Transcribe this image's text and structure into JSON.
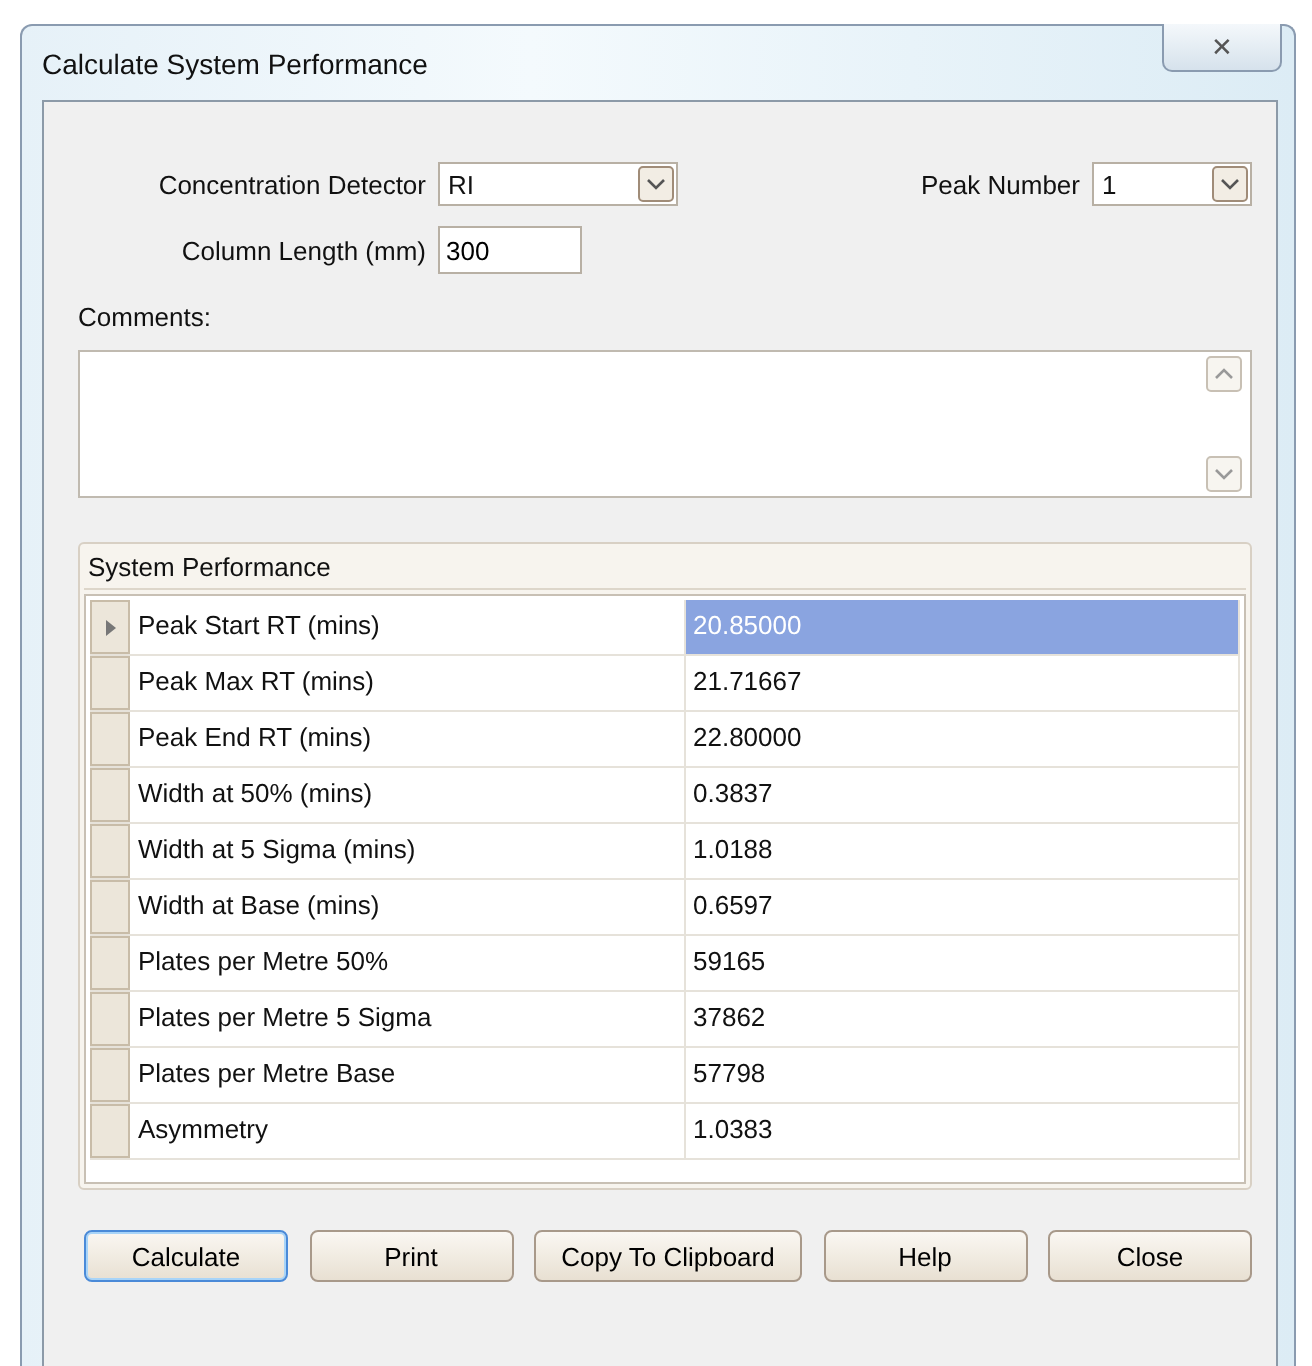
{
  "window": {
    "title": "Calculate System Performance",
    "close": "✕"
  },
  "form": {
    "detector_label": "Concentration Detector",
    "detector_value": "RI",
    "peak_label": "Peak Number",
    "peak_value": "1",
    "length_label": "Column Length (mm)",
    "length_value": "300",
    "comments_label": "Comments:"
  },
  "table": {
    "title": "System Performance",
    "rows": [
      {
        "label": "Peak Start RT (mins)",
        "value": "20.85000",
        "selected": true
      },
      {
        "label": "Peak Max RT (mins)",
        "value": "21.71667",
        "selected": false
      },
      {
        "label": "Peak End RT (mins)",
        "value": "22.80000",
        "selected": false
      },
      {
        "label": "Width at 50% (mins)",
        "value": "0.3837",
        "selected": false
      },
      {
        "label": "Width at 5 Sigma (mins)",
        "value": "1.0188",
        "selected": false
      },
      {
        "label": "Width at Base (mins)",
        "value": "0.6597",
        "selected": false
      },
      {
        "label": "Plates per Metre 50%",
        "value": "59165",
        "selected": false
      },
      {
        "label": "Plates per Metre 5 Sigma",
        "value": "37862",
        "selected": false
      },
      {
        "label": "Plates per Metre Base",
        "value": "57798",
        "selected": false
      },
      {
        "label": "Asymmetry",
        "value": "1.0383",
        "selected": false
      }
    ]
  },
  "buttons": [
    {
      "label": "Calculate",
      "focused": true
    },
    {
      "label": "Print",
      "focused": false
    },
    {
      "label": "Copy To Clipboard",
      "focused": false
    },
    {
      "label": "Help",
      "focused": false
    },
    {
      "label": "Close",
      "focused": false
    }
  ]
}
